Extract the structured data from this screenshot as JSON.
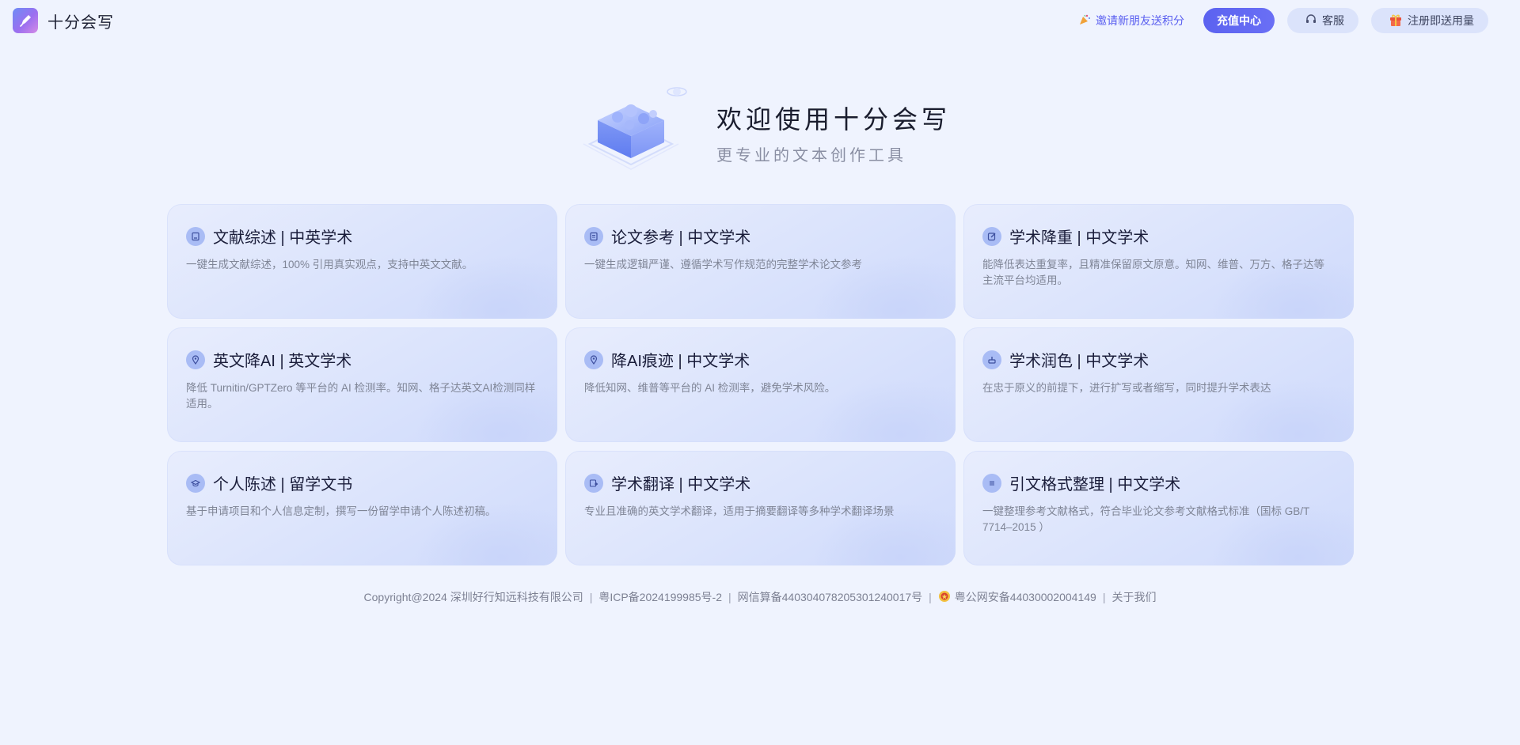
{
  "header": {
    "brand_name": "十分会写",
    "invite_label": "邀请新朋友送积分",
    "recharge_label": "充值中心",
    "service_label": "客服",
    "register_label": "注册即送用量"
  },
  "hero": {
    "title": "欢迎使用十分会写",
    "subtitle": "更专业的文本创作工具"
  },
  "cards": [
    {
      "title": "文献综述 | 中英学术",
      "desc": "一键生成文献综述，100% 引用真实观点，支持中英文文献。",
      "icon": "book-icon"
    },
    {
      "title": "论文参考 | 中文学术",
      "desc": "一键生成逻辑严谨、遵循学术写作规范的完整学术论文参考",
      "icon": "document-icon"
    },
    {
      "title": "学术降重 | 中文学术",
      "desc": "能降低表达重复率，且精准保留原文原意。知网、维普、万方、格子达等主流平台均适用。",
      "icon": "edit-icon"
    },
    {
      "title": "英文降AI | 英文学术",
      "desc": "降低 Turnitin/GPTZero 等平台的 AI 检测率。知网、格子达英文AI检测同样适用。",
      "icon": "location-pin-icon"
    },
    {
      "title": "降AI痕迹 | 中文学术",
      "desc": "降低知网、维普等平台的 AI 检测率，避免学术风险。",
      "icon": "location-pin-icon"
    },
    {
      "title": "学术润色 | 中文学术",
      "desc": "在忠于原义的前提下，进行扩写或者缩写，同时提升学术表达",
      "icon": "brush-icon"
    },
    {
      "title": "个人陈述 | 留学文书",
      "desc": "基于申请项目和个人信息定制，撰写一份留学申请个人陈述初稿。",
      "icon": "graduation-cap-icon"
    },
    {
      "title": "学术翻译 | 中文学术",
      "desc": "专业且准确的英文学术翻译，适用于摘要翻译等多种学术翻译场景",
      "icon": "translate-icon"
    },
    {
      "title": "引文格式整理 | 中文学术",
      "desc": "一键整理参考文献格式，符合毕业论文参考文献格式标准（国标 GB/T 7714–2015 ）",
      "icon": "list-icon"
    }
  ],
  "footer": {
    "copyright": "Copyright@2024 深圳好行知远科技有限公司",
    "icp": "粤ICP备2024199985号-2",
    "algo": "网信算备440304078205301240017号",
    "police": "粤公网安备44030002004149",
    "about": "关于我们",
    "separator": "|"
  },
  "colors": {
    "accent": "#5b62f0",
    "background": "#eff3fe",
    "card": "#dde5fc"
  }
}
